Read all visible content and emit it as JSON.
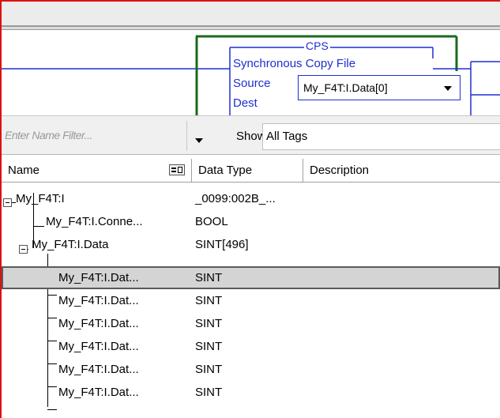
{
  "ladder": {
    "instruction": "CPS",
    "instruction_desc": "Synchronous Copy File",
    "source_label": "Source",
    "source_value": "My_F4T:I.Data[0]",
    "dest_label": "Dest"
  },
  "filter": {
    "placeholder": "Enter Name Filter...",
    "show_label": "Show:",
    "show_value": "All Tags"
  },
  "columns": [
    "Name",
    "Data Type",
    "Description"
  ],
  "rows": [
    {
      "name": "My_F4T:I",
      "type": "_0099:002B_..."
    },
    {
      "name": "My_F4T:I.Conne...",
      "type": "BOOL"
    },
    {
      "name": "My_F4T:I.Data",
      "type": "SINT[496]"
    },
    {
      "name": "My_F4T:I.Dat...",
      "type": "SINT"
    },
    {
      "name": "My_F4T:I.Dat...",
      "type": "SINT"
    },
    {
      "name": "My_F4T:I.Dat...",
      "type": "SINT"
    },
    {
      "name": "My_F4T:I.Dat...",
      "type": "SINT"
    },
    {
      "name": "My_F4T:I.Dat...",
      "type": "SINT"
    },
    {
      "name": "My_F4T:I.Dat...",
      "type": "SINT"
    }
  ],
  "colors": {
    "window_border": "#e01010",
    "ladder_blue": "#1f2fd0",
    "rung_green": "#1a6a1a",
    "selection": "#d4d4d4"
  }
}
